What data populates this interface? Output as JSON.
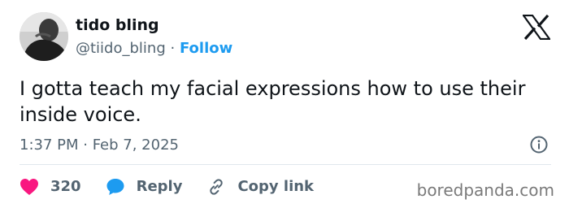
{
  "author": {
    "display_name": "tido bling",
    "handle": "@tiido_bling",
    "separator": "·",
    "follow_label": "Follow"
  },
  "tweet": {
    "text": "I gotta teach my facial expressions how to use their inside voice.",
    "timestamp": "1:37 PM · Feb 7, 2025"
  },
  "actions": {
    "like_count": "320",
    "reply_label": "Reply",
    "copy_link_label": "Copy link"
  },
  "icons": {
    "platform": "x-logo-icon",
    "info": "info-icon",
    "like": "heart-icon",
    "reply": "speech-bubble-icon",
    "copy_link": "link-icon"
  },
  "colors": {
    "accent": "#1d9bf0",
    "like": "#f91880",
    "secondary_text": "#536471"
  },
  "watermark": "boredpanda.com"
}
